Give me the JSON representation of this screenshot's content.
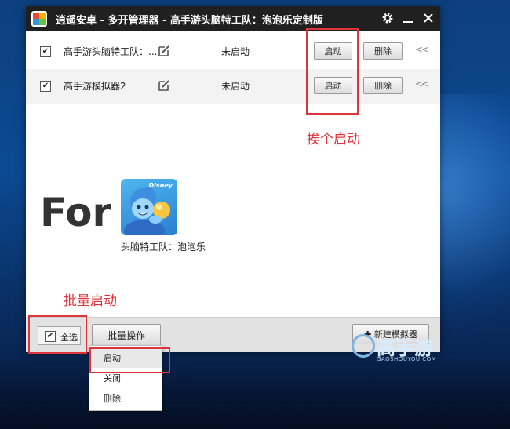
{
  "window": {
    "title": "逍遥安卓 - 多开管理器 - 高手游头脑特工队：泡泡乐定制版"
  },
  "instances": [
    {
      "checked": "✔",
      "name": "高手游头脑特工队：...",
      "status": "未启动",
      "start_label": "启动",
      "delete_label": "删除",
      "more": "<<"
    },
    {
      "checked": "✔",
      "name": "高手游模拟器2",
      "status": "未启动",
      "start_label": "启动",
      "delete_label": "删除",
      "more": "<<"
    }
  ],
  "annotations": {
    "start_one": "挨个启动",
    "batch_start": "批量启动"
  },
  "promo": {
    "for_text": "For",
    "game_brand": "Disney",
    "caption": "头脑特工队：泡泡乐"
  },
  "bottom": {
    "select_all_check": "✔",
    "select_all_label": "全选",
    "batch_label": "批量操作",
    "new_sim_label": "✚ 新建模拟器"
  },
  "batch_menu": [
    "启动",
    "关闭",
    "删除"
  ],
  "watermark": {
    "name": "高手游",
    "sub": "GAOSHOUYOU.COM"
  },
  "colors": {
    "accent_red": "#e0343c",
    "titlebar": "#202020"
  }
}
